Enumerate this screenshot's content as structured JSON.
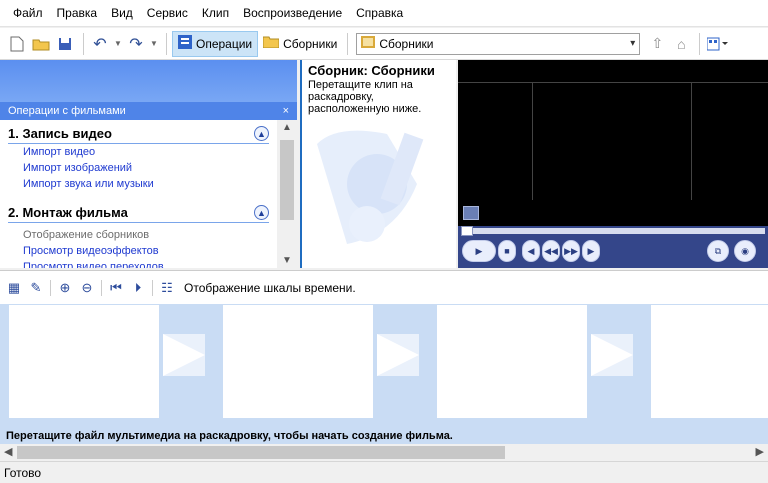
{
  "menu": [
    "Файл",
    "Правка",
    "Вид",
    "Сервис",
    "Клип",
    "Воспроизведение",
    "Справка"
  ],
  "toolbar": {
    "operations_label": "Операции",
    "collections_label": "Сборники",
    "combo_value": "Сборники"
  },
  "taskpane": {
    "title": "Операции с фильмами",
    "close": "×",
    "sections": [
      {
        "title": "1. Запись видео",
        "links": [
          "Импорт видео",
          "Импорт изображений",
          "Импорт звука или музыки"
        ]
      },
      {
        "title": "2. Монтаж фильма",
        "links": [
          "Отображение сборников",
          "Просмотр видеоэффектов",
          "Просмотр видео переходов"
        ]
      }
    ]
  },
  "collections": {
    "title": "Сборник: Сборники",
    "description": "Перетащите клип на раскадровку, расположенную ниже."
  },
  "storyboard": {
    "timeline_label": "Отображение шкалы времени.",
    "hint": "Перетащите файл мультимедиа на раскадровку, чтобы начать создание фильма."
  },
  "status": {
    "text": "Готово"
  }
}
